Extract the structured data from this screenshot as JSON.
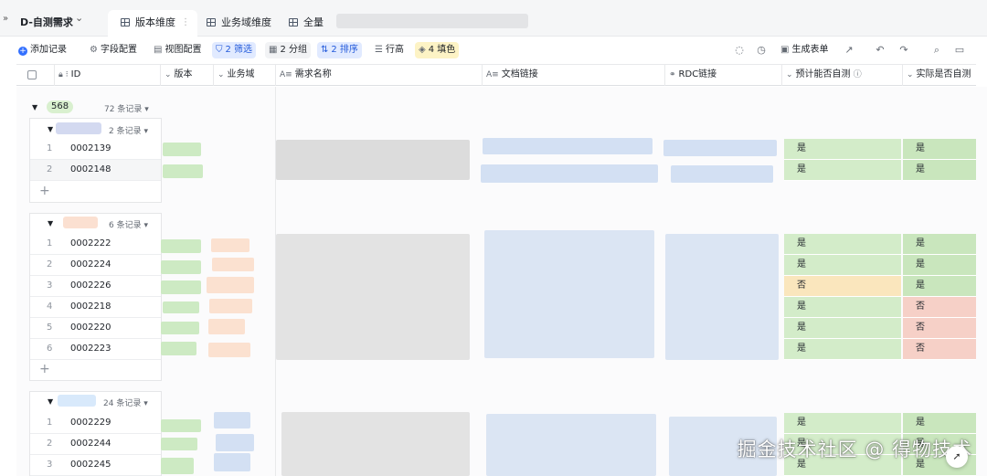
{
  "topbar": {
    "table_name": "D-自测需求",
    "tabs": [
      {
        "label": "版本维度",
        "active": true
      },
      {
        "label": "业务域维度",
        "active": false
      },
      {
        "label": "全量",
        "active": false
      }
    ]
  },
  "toolbar": {
    "add_record": "添加记录",
    "field_config": "字段配置",
    "view_config": "视图配置",
    "filter": "2 筛选",
    "group": "2 分组",
    "sort": "2 排序",
    "row_height": "行高",
    "fill_color": "4 填色",
    "generate_form": "生成表单"
  },
  "columns": {
    "id": "ID",
    "version": "版本",
    "business_domain": "业务域",
    "requirement_name": "需求名称",
    "doc_link": "文档链接",
    "rdc_link": "RDC链接",
    "expected_self_test": "预计能否自测",
    "actual_self_test": "实际是否自测"
  },
  "groups": [
    {
      "tag": "568",
      "count": "72 条记录"
    },
    {
      "count": "2 条记录",
      "rows": [
        {
          "num": "1",
          "id": "0002139",
          "expected": "是",
          "actual": "是"
        },
        {
          "num": "2",
          "id": "0002148",
          "expected": "是",
          "actual": "是"
        }
      ]
    },
    {
      "count": "6 条记录",
      "rows": [
        {
          "num": "1",
          "id": "0002222",
          "expected": "是",
          "actual": "是"
        },
        {
          "num": "2",
          "id": "0002224",
          "expected": "是",
          "actual": "是"
        },
        {
          "num": "3",
          "id": "0002226",
          "expected": "否",
          "actual": "是"
        },
        {
          "num": "4",
          "id": "0002218",
          "expected": "是",
          "actual": "否"
        },
        {
          "num": "5",
          "id": "0002220",
          "expected": "是",
          "actual": "否"
        },
        {
          "num": "6",
          "id": "0002223",
          "expected": "是",
          "actual": "否"
        }
      ]
    },
    {
      "count": "24 条记录",
      "rows": [
        {
          "num": "1",
          "id": "0002229",
          "expected": "是",
          "actual": "是"
        },
        {
          "num": "2",
          "id": "0002244",
          "expected": "是",
          "actual": "是"
        },
        {
          "num": "3",
          "id": "0002245",
          "expected": "是",
          "actual": "是"
        }
      ]
    }
  ],
  "watermark": "掘金技术社区 @ 得物技术",
  "colors": {
    "accent": "#3370ff",
    "yes": "#d3ecc9",
    "no_expected": "#fae6bd",
    "no_actual": "#f6d0c7"
  }
}
